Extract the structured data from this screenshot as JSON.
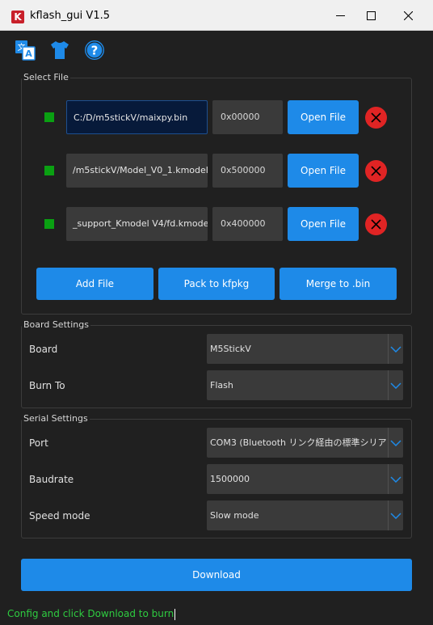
{
  "window": {
    "title": "kflash_gui V1.5",
    "logo_text": "K"
  },
  "toolbar": {
    "icons": [
      "translate-icon",
      "shirt-icon",
      "help-icon"
    ],
    "accent_color": "#1e8ae8"
  },
  "select_file": {
    "label": "Select File",
    "files": [
      {
        "path": "C:/D/m5stickV/maixpy.bin",
        "address": "0x00000",
        "open_label": "Open File",
        "status_color": "#0aa012"
      },
      {
        "path": "/m5stickV/Model_V0_1.kmodel",
        "address": "0x500000",
        "open_label": "Open File",
        "status_color": "#0aa012"
      },
      {
        "path": "_support_Kmodel V4/fd.kmodel",
        "address": "0x400000",
        "open_label": "Open File",
        "status_color": "#0aa012"
      }
    ],
    "actions": {
      "add_file": "Add File",
      "pack": "Pack to kfpkg",
      "merge": "Merge to .bin"
    }
  },
  "board_settings": {
    "label": "Board Settings",
    "board": {
      "label": "Board",
      "value": "M5StickV"
    },
    "burn_to": {
      "label": "Burn To",
      "value": "Flash"
    }
  },
  "serial_settings": {
    "label": "Serial Settings",
    "port": {
      "label": "Port",
      "value": "COM3 (Bluetooth リンク経由の標準シリア,"
    },
    "baudrate": {
      "label": "Baudrate",
      "value": "1500000"
    },
    "speed_mode": {
      "label": "Speed mode",
      "value": "Slow mode"
    }
  },
  "download_label": "Download",
  "status_message": "Config and click Download to burn"
}
